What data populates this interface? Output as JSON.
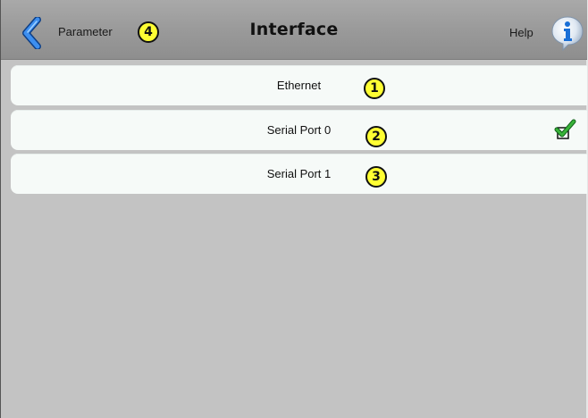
{
  "header": {
    "back_label": "Parameter",
    "title": "Interface",
    "help_label": "Help",
    "back_icon": "chevron-left-icon",
    "help_icon": "info-icon"
  },
  "list": {
    "items": [
      {
        "label": "Ethernet",
        "selected": false
      },
      {
        "label": "Serial Port 0",
        "selected": true
      },
      {
        "label": "Serial Port 1",
        "selected": false
      }
    ]
  },
  "callouts": [
    "1",
    "2",
    "3",
    "4"
  ],
  "colors": {
    "header": "#9a9a9a",
    "background": "#c3c3c3",
    "row": "#f6faf8",
    "accent": "#1a6fd6",
    "callout": "#ffff33",
    "check": "#2a9a2a"
  }
}
